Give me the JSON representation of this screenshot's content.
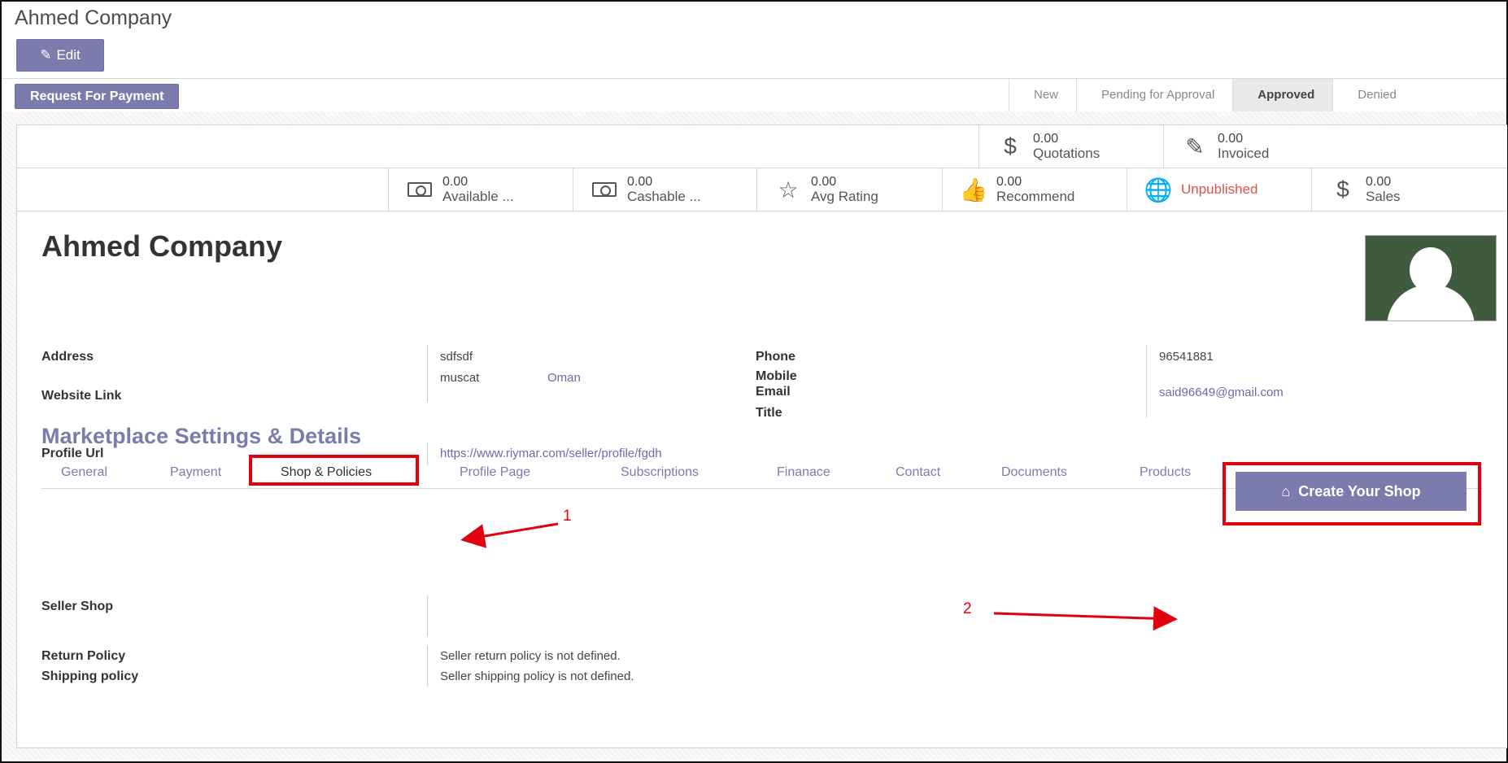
{
  "header": {
    "title": "Ahmed Company",
    "edit_label": "Edit",
    "request_payment_label": "Request For Payment",
    "stages": [
      {
        "label": "New"
      },
      {
        "label": "Pending for Approval"
      },
      {
        "label": "Approved"
      },
      {
        "label": "Denied"
      }
    ],
    "active_stage": "Approved"
  },
  "smart_buttons": {
    "row1": [
      {
        "value": "0.00",
        "label": "Quotations",
        "icon": "dollar-icon"
      },
      {
        "value": "0.00",
        "label": "Invoiced",
        "icon": "pencil-square-icon"
      }
    ],
    "row2": [
      {
        "value": "0.00",
        "label": "Available ...",
        "icon": "money-icon"
      },
      {
        "value": "0.00",
        "label": "Cashable ...",
        "icon": "money-icon"
      },
      {
        "value": "0.00",
        "label": "Avg Rating",
        "icon": "star-icon"
      },
      {
        "value": "0.00",
        "label": "Recommend",
        "icon": "thumbs-up-icon"
      },
      {
        "value": "",
        "label": "Unpublished",
        "icon": "globe-icon"
      },
      {
        "value": "0.00",
        "label": "Sales",
        "icon": "dollar-icon"
      }
    ]
  },
  "record": {
    "name": "Ahmed Company",
    "fields": {
      "address_label": "Address",
      "address_street": "sdfsdf",
      "address_city": "muscat",
      "address_country": "Oman",
      "website_label": "Website Link",
      "phone_label": "Phone",
      "phone_value": "96541881",
      "mobile_label": "Mobile",
      "email_label": "Email",
      "email_value": "said96649@gmail.com",
      "title_label": "Title",
      "profile_url_label": "Profile Url",
      "profile_url_value": "https://www.riymar.com/seller/profile/fgdh"
    }
  },
  "marketplace": {
    "section_title": "Marketplace Settings & Details",
    "tabs": [
      {
        "label": "General"
      },
      {
        "label": "Payment"
      },
      {
        "label": "Shop & Policies"
      },
      {
        "label": "Profile Page"
      },
      {
        "label": "Subscriptions"
      },
      {
        "label": "Finanace"
      },
      {
        "label": "Contact"
      },
      {
        "label": "Documents"
      },
      {
        "label": "Products"
      }
    ],
    "active_tab": "Shop & Policies",
    "seller_shop_label": "Seller Shop",
    "create_shop_label": "Create Your Shop",
    "return_policy_label": "Return Policy",
    "return_policy_value": "Seller return policy is not defined.",
    "shipping_policy_label": "Shipping policy",
    "shipping_policy_value": "Seller shipping policy is not defined."
  },
  "annotations": {
    "step1": "1",
    "step2": "2"
  },
  "colors": {
    "primary": "#7c7bad",
    "annotation_red": "#e0000e",
    "unpublished_red": "#d9534f",
    "avatar_bg": "#3f5a3c"
  }
}
